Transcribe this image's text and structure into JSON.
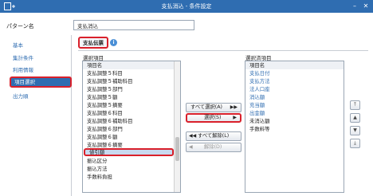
{
  "window": {
    "title": "支払消込 - 条件設定"
  },
  "pattern": {
    "label": "パターン名",
    "value": "支払消込"
  },
  "sidebar": {
    "items": [
      {
        "label": "基本"
      },
      {
        "label": "集計条件"
      },
      {
        "label": "利用情報"
      },
      {
        "label": "項目選択",
        "active": true
      },
      {
        "label": "出力順"
      }
    ]
  },
  "section": {
    "tab_label": "支払伝票",
    "info_icon": "info-icon"
  },
  "available": {
    "title": "選択項目",
    "header": "項目名",
    "items": [
      "支払調整５科目",
      "支払調整５補助科目",
      "支払調整５部門",
      "支払調整５額",
      "支払調整５摘要",
      "支払調整６科目",
      "支払調整６補助科目",
      "支払調整６部門",
      "支払調整６額",
      "支払調整６摘要",
      "値引額",
      "振込区分",
      "振込方法",
      "手数料負担"
    ],
    "selected_item": "値引額"
  },
  "chosen": {
    "title": "選択済項目",
    "header": "項目名",
    "items": [
      {
        "label": "支払日付",
        "color": "#2f6db1"
      },
      {
        "label": "支払方法",
        "color": "#2f6db1"
      },
      {
        "label": "法人口座",
        "color": "#2f6db1"
      },
      {
        "label": "消込額",
        "color": "#2f6db1"
      },
      {
        "label": "充当額",
        "color": "#2f6db1"
      },
      {
        "label": "出金額",
        "color": "#2f6db1"
      },
      {
        "label": "未消込額",
        "color": "#222222"
      },
      {
        "label": "手数料等",
        "color": "#222222"
      }
    ]
  },
  "buttons": {
    "select_all": "すべて選択(A)",
    "select": "選択(S)",
    "deselect_all": "すべて解除(L)",
    "deselect": "解除(D)"
  },
  "colors": {
    "accent": "#2f6db1",
    "highlight": "#d9202b",
    "selection": "#c9d9ef"
  }
}
